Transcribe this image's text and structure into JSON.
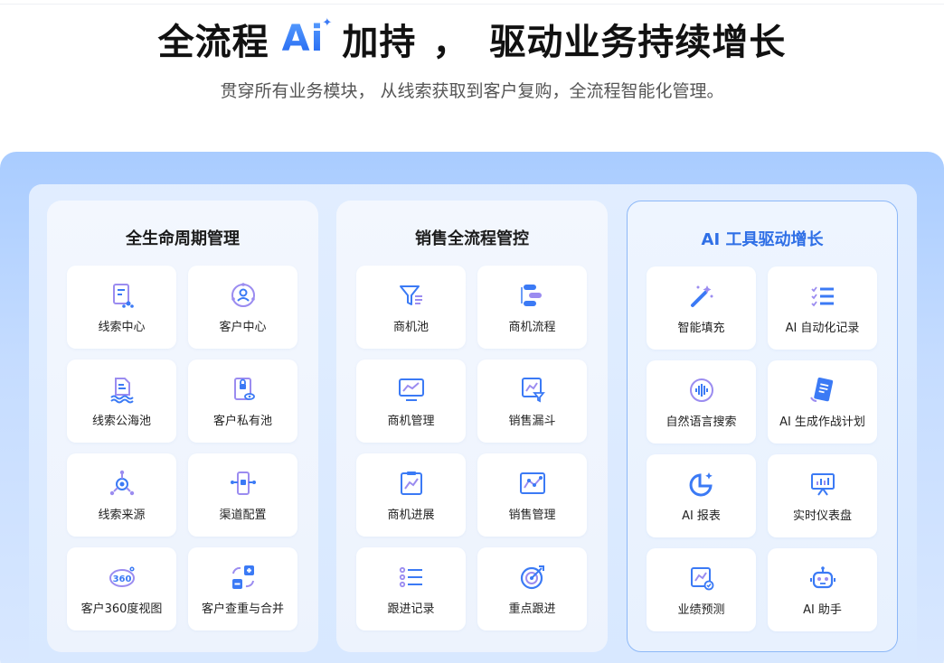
{
  "hero": {
    "title_left": "全流程",
    "ai_badge": "Ai",
    "title_mid": "加持",
    "title_comma": "，",
    "title_right": "驱动业务持续增长",
    "subtitle": "贯穿所有业务模块， 从线索获取到客户复购，全流程智能化管理。"
  },
  "columns": [
    {
      "title": "全生命周期管理",
      "items": [
        {
          "label": "线索中心",
          "icon": "lead-doc-icon"
        },
        {
          "label": "客户中心",
          "icon": "customer-network-icon"
        },
        {
          "label": "线索公海池",
          "icon": "lead-pool-icon"
        },
        {
          "label": "客户私有池",
          "icon": "private-pool-icon"
        },
        {
          "label": "线索来源",
          "icon": "source-graph-icon"
        },
        {
          "label": "渠道配置",
          "icon": "channel-config-icon"
        },
        {
          "label": "客户360度视图",
          "icon": "view-360-icon"
        },
        {
          "label": "客户查重与合并",
          "icon": "merge-icon"
        }
      ]
    },
    {
      "title": "销售全流程管控",
      "items": [
        {
          "label": "商机池",
          "icon": "funnel-icon"
        },
        {
          "label": "商机流程",
          "icon": "flow-icon"
        },
        {
          "label": "商机管理",
          "icon": "monitor-chart-icon"
        },
        {
          "label": "销售漏斗",
          "icon": "sales-funnel-icon"
        },
        {
          "label": "商机进展",
          "icon": "clipboard-chart-icon"
        },
        {
          "label": "销售管理",
          "icon": "sales-line-icon"
        },
        {
          "label": "跟进记录",
          "icon": "checklist-icon"
        },
        {
          "label": "重点跟进",
          "icon": "target-icon"
        }
      ]
    },
    {
      "title": "AI 工具驱动增长",
      "items": [
        {
          "label": "智能填充",
          "icon": "magic-wand-icon"
        },
        {
          "label": "AI 自动化记录",
          "icon": "list-check-icon"
        },
        {
          "label": "自然语言搜索",
          "icon": "voice-icon"
        },
        {
          "label": "AI 生成作战计划",
          "icon": "plan-doc-icon"
        },
        {
          "label": "AI 报表",
          "icon": "pie-chart-icon"
        },
        {
          "label": "实时仪表盘",
          "icon": "dashboard-icon"
        },
        {
          "label": "业绩预测",
          "icon": "forecast-icon"
        },
        {
          "label": "AI 助手",
          "icon": "robot-icon"
        }
      ]
    }
  ],
  "colors": {
    "accent": "#2f6fe6",
    "icon_primary": "#3b7af5",
    "icon_secondary": "#9b8cf0"
  }
}
